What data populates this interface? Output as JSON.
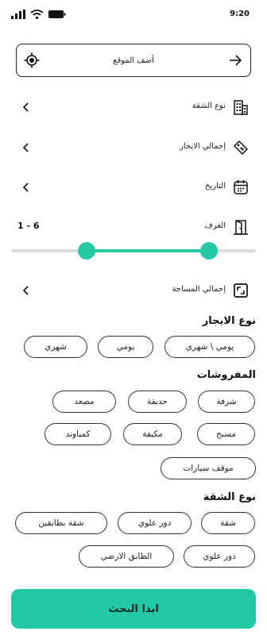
{
  "status_bar": {
    "time": "9:20"
  },
  "location": {
    "placeholder": "أضف الموقع"
  },
  "filters": {
    "apartment_type": "نوع الشقة",
    "total_rent": "إجمالي الايجار",
    "date": "التاريخ",
    "rooms": "الغرف",
    "total_area": "إجمالي المساحة"
  },
  "rooms_slider": {
    "range_label": "1 - 6",
    "min": 1,
    "max": 6,
    "low_fraction": 0.31,
    "high_fraction": 0.81
  },
  "rent_type": {
    "title": "نوع الايجار",
    "chips": [
      "يومي \\ شهري",
      "يومي",
      "شهري"
    ]
  },
  "furnishings": {
    "title": "المفروشات",
    "chips": [
      "شرفة",
      "حديقة",
      "مصعد",
      "مسبح",
      "مكيفة",
      "كمباوند",
      "موقف سيارات"
    ]
  },
  "apartment_kind": {
    "title": "نوع الشقة",
    "chips": [
      "شقة",
      "دور علوي",
      "شقة بطابقين",
      "دور علوي",
      "الطابق الارضي"
    ]
  },
  "search_button": {
    "label": "ابدا البحث"
  },
  "colors": {
    "accent": "#22c9a4",
    "track": "#dcdcdc",
    "border": "#222222"
  }
}
